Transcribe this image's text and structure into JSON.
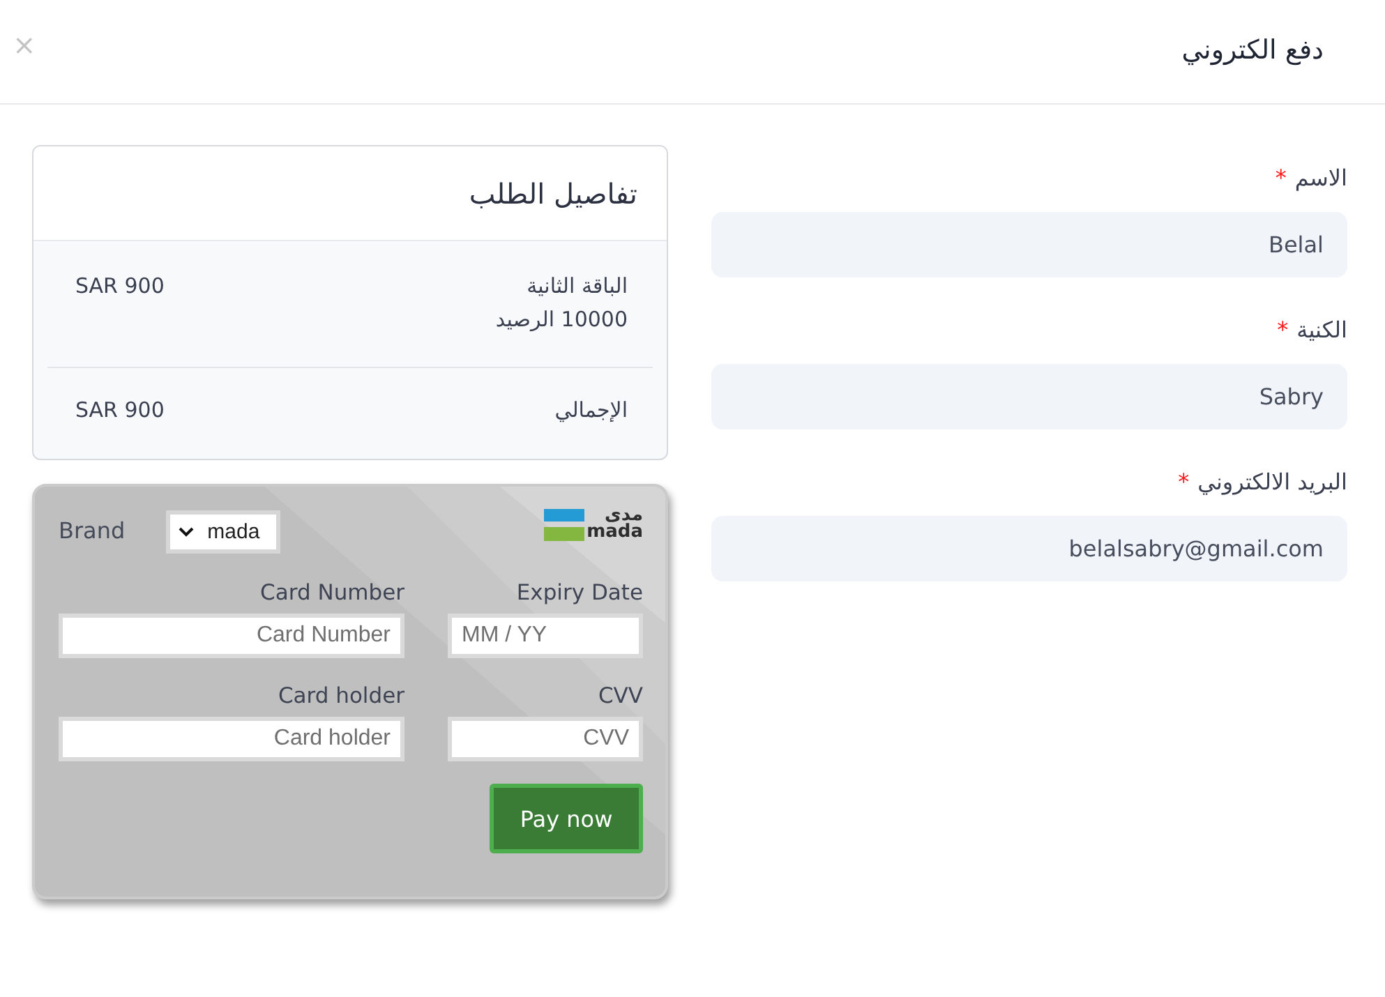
{
  "dialog": {
    "title": "دفع الكتروني",
    "close": "×"
  },
  "form": {
    "fields": [
      {
        "label": "الاسم",
        "required_mark": "*",
        "value": "Belal"
      },
      {
        "label": "الكنية",
        "required_mark": "*",
        "value": "Sabry"
      },
      {
        "label": "البريد الالكتروني",
        "required_mark": "*",
        "value": "belalsabry@gmail.com"
      }
    ]
  },
  "order_details": {
    "title": "تفاصيل الطلب",
    "rows": [
      {
        "label": "الباقة الثانية",
        "note": "10000 الرصيد",
        "price": "SAR 900"
      },
      {
        "label": "الإجمالي",
        "price": "SAR 900"
      }
    ]
  },
  "payment_card": {
    "brand": {
      "label": "Brand",
      "value": "mada"
    },
    "logo": {
      "arabic": "مدى",
      "latin": "mada"
    },
    "fields": [
      {
        "kind": "expiry",
        "label": "Expiry Date",
        "placeholder": "MM / YY"
      },
      {
        "kind": "card_number",
        "label": "Card Number",
        "placeholder": "Card Number"
      },
      {
        "kind": "cvv",
        "label": "CVV",
        "placeholder": "CVV"
      },
      {
        "kind": "card_holder",
        "label": "Card holder",
        "placeholder": "Card holder"
      }
    ],
    "submit": "Pay now"
  }
}
